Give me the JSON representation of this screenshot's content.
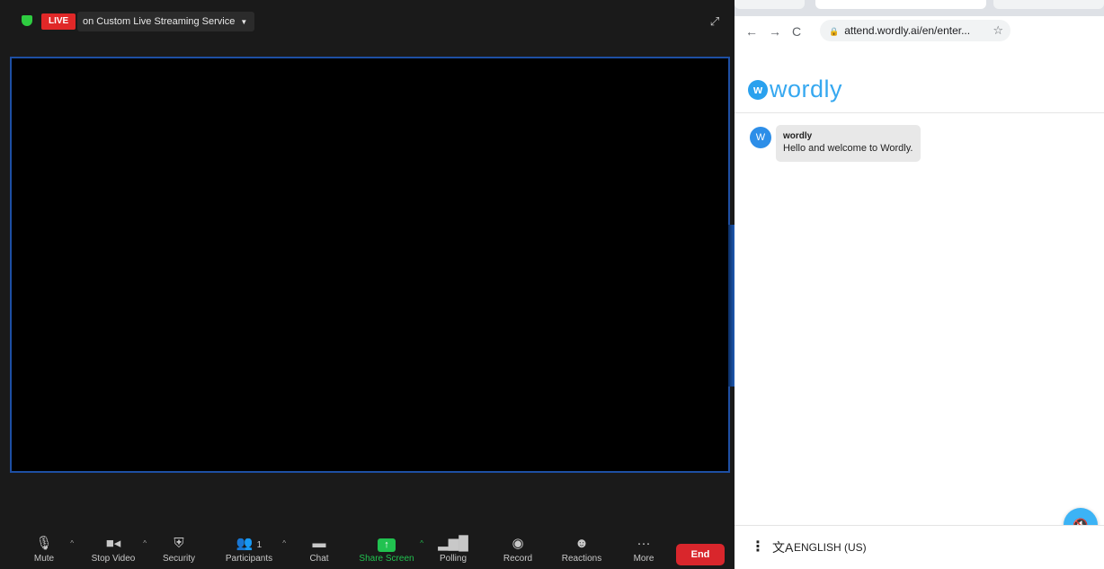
{
  "zoom": {
    "live_badge": "LIVE",
    "stream_label": "on Custom Live Streaming Service",
    "toolbar": {
      "mute": "Mute",
      "stop_video": "Stop Video",
      "security": "Security",
      "participants": "Participants",
      "participants_count": "1",
      "chat": "Chat",
      "share_screen": "Share Screen",
      "polling": "Polling",
      "record": "Record",
      "reactions": "Reactions",
      "more": "More",
      "end": "End"
    }
  },
  "browser": {
    "url": "attend.wordly.ai/en/enter...",
    "wordly": {
      "logo_letter": "w",
      "logo_text": "wordly",
      "message": {
        "avatar": "W",
        "sender": "wordly",
        "text": "Hello and welcome to Wordly."
      },
      "language": "ENGLISH (US)"
    }
  },
  "colors": {
    "live": "#e02828",
    "share": "#21c250",
    "end": "#d9262c",
    "wordly_blue": "#36a8f0"
  }
}
